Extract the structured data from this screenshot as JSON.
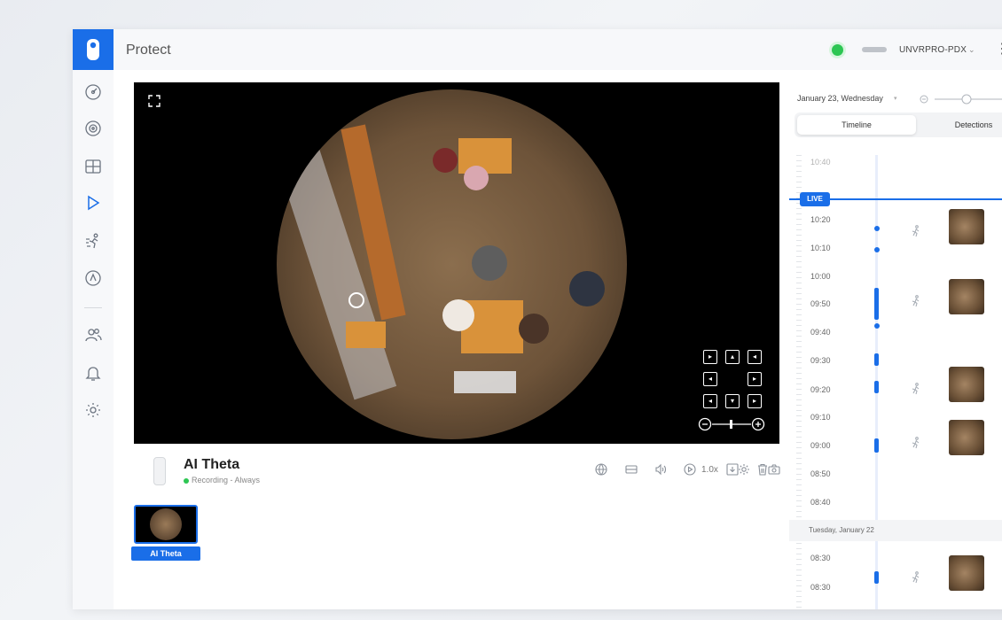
{
  "app": {
    "title": "Protect"
  },
  "header": {
    "nvr_name": "UNVRPRO-PDX",
    "status_color": "#2dc653"
  },
  "sidebar": {
    "items": [
      {
        "icon": "dashboard-icon"
      },
      {
        "icon": "camera-icon"
      },
      {
        "icon": "grid-icon"
      },
      {
        "icon": "play-icon"
      },
      {
        "icon": "motion-icon"
      },
      {
        "icon": "map-icon"
      },
      {
        "icon": "users-icon"
      },
      {
        "icon": "bell-icon"
      },
      {
        "icon": "gear-icon"
      }
    ]
  },
  "player": {
    "camera_name": "AI Theta",
    "recording_status": "Recording - Always",
    "speed": "1.0x"
  },
  "thumbnails": [
    {
      "label": "AI Theta"
    }
  ],
  "timeline": {
    "date": "January 23, Wednesday",
    "tabs": [
      "Timeline",
      "Detections"
    ],
    "active_tab": "Timeline",
    "live_label": "LIVE",
    "labels": [
      "10:40",
      "10:20",
      "10:10",
      "10:00",
      "09:50",
      "09:40",
      "09:30",
      "09:20",
      "09:10",
      "09:00",
      "08:50",
      "08:40",
      "08:30",
      "08:30"
    ],
    "day_separator": "Tuesday, January 22"
  },
  "colors": {
    "accent": "#1a6ee8",
    "recording": "#2dc653"
  }
}
